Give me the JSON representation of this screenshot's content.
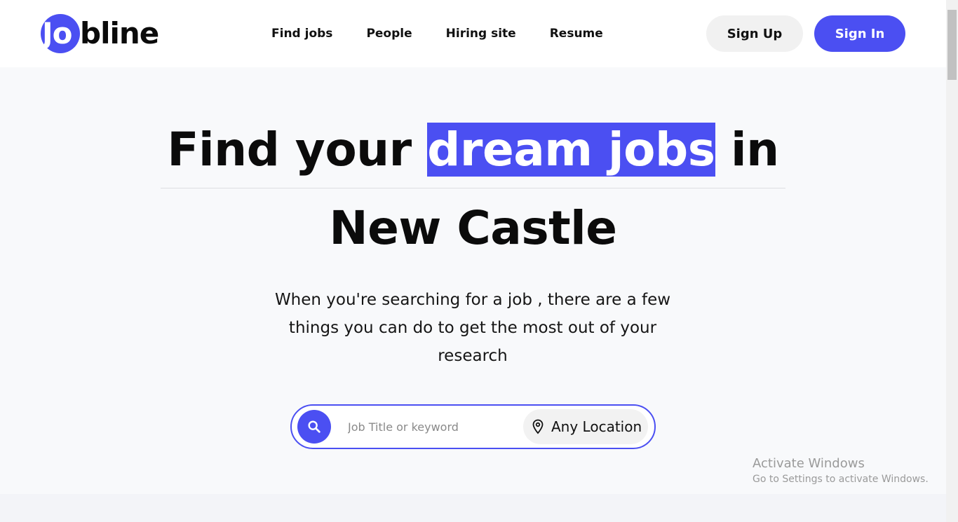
{
  "brand": {
    "logo_prefix": "Jo",
    "logo_suffix": "bline",
    "accent": "#4b4ff2"
  },
  "nav": {
    "items": [
      {
        "label": "Find jobs"
      },
      {
        "label": "People"
      },
      {
        "label": "Hiring site"
      },
      {
        "label": "Resume"
      }
    ]
  },
  "auth": {
    "signup_label": "Sign Up",
    "signin_label": "Sign In"
  },
  "hero": {
    "title_before": "Find your ",
    "title_highlight": "dream jobs",
    "title_after": " in",
    "title_line2": "New Castle",
    "subtitle": "When you're searching for a job , there are a few things you can do to get the most out of your research"
  },
  "search": {
    "icon": "search-icon",
    "placeholder": "Job Title or keyword",
    "value": "",
    "location_icon": "map-pin-icon",
    "location_label": "Any Location"
  },
  "watermark": {
    "title": "Activate Windows",
    "subtitle": "Go to Settings to activate Windows."
  }
}
